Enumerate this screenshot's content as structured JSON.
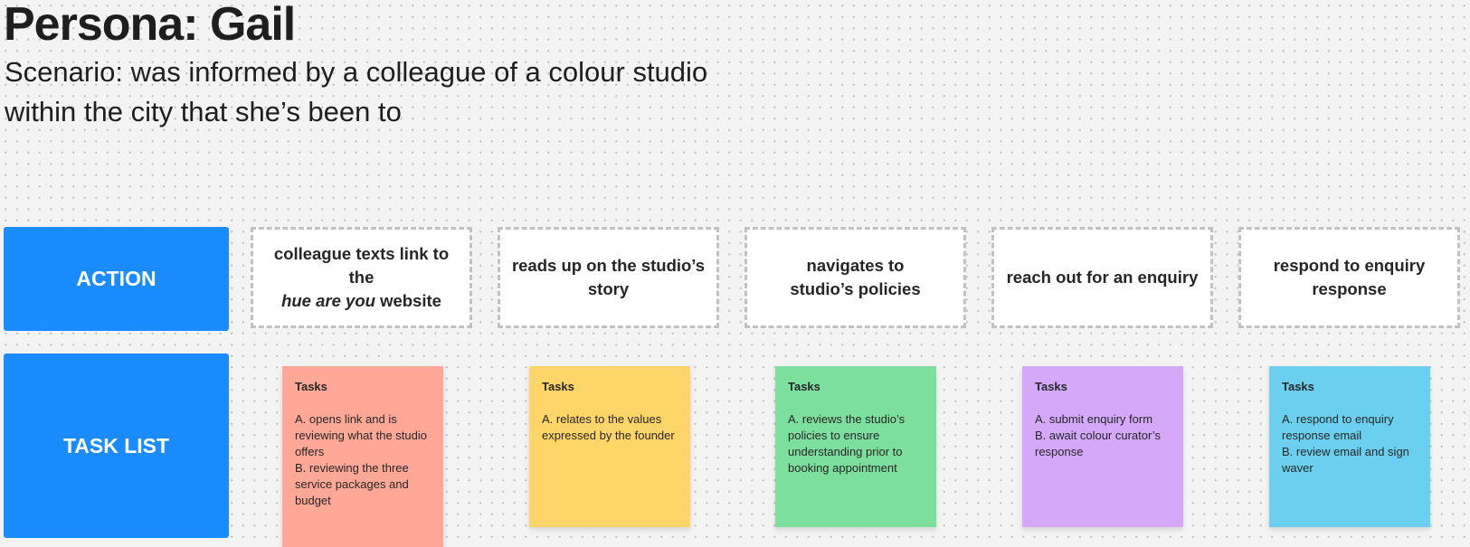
{
  "persona": {
    "title": "Persona: Gail",
    "scenario_lines": [
      "Scenario: was informed by a colleague of a colour studio",
      "within the city that she’s been to"
    ]
  },
  "rows": {
    "action_label": "ACTION",
    "task_list_label": "TASK LIST"
  },
  "actions": [
    {
      "text_before": "colleague texts link to the",
      "text_emphasis": "hue are you",
      "text_after": "website"
    },
    {
      "text": "reads up on the studio’s story"
    },
    {
      "text": "navigates to studio’s policies"
    },
    {
      "text": "reach out for an enquiry"
    },
    {
      "text": "respond to enquiry response"
    }
  ],
  "stickies": [
    {
      "color": "#ffa898",
      "heading": "Tasks",
      "lines": [
        "A. opens link and is reviewing what the studio offers",
        "B. reviewing the three service packages and budget"
      ]
    },
    {
      "color": "#fed569",
      "heading": "Tasks",
      "lines": [
        "A. relates to the values expressed by the founder"
      ]
    },
    {
      "color": "#7ddf9d",
      "heading": "Tasks",
      "lines": [
        "A. reviews the studio’s policies to ensure understanding prior to booking appointment"
      ]
    },
    {
      "color": "#d4a9fa",
      "heading": "Tasks",
      "lines": [
        "A. submit enquiry form",
        "B. await colour curator’s response"
      ]
    },
    {
      "color": "#6bd0ef",
      "heading": "Tasks",
      "lines": [
        "A. respond to enquiry response email",
        "B. review email and sign waver"
      ]
    }
  ],
  "colors": {
    "label_blue": "#1b8cff",
    "canvas_bg": "#f3f3f3"
  }
}
